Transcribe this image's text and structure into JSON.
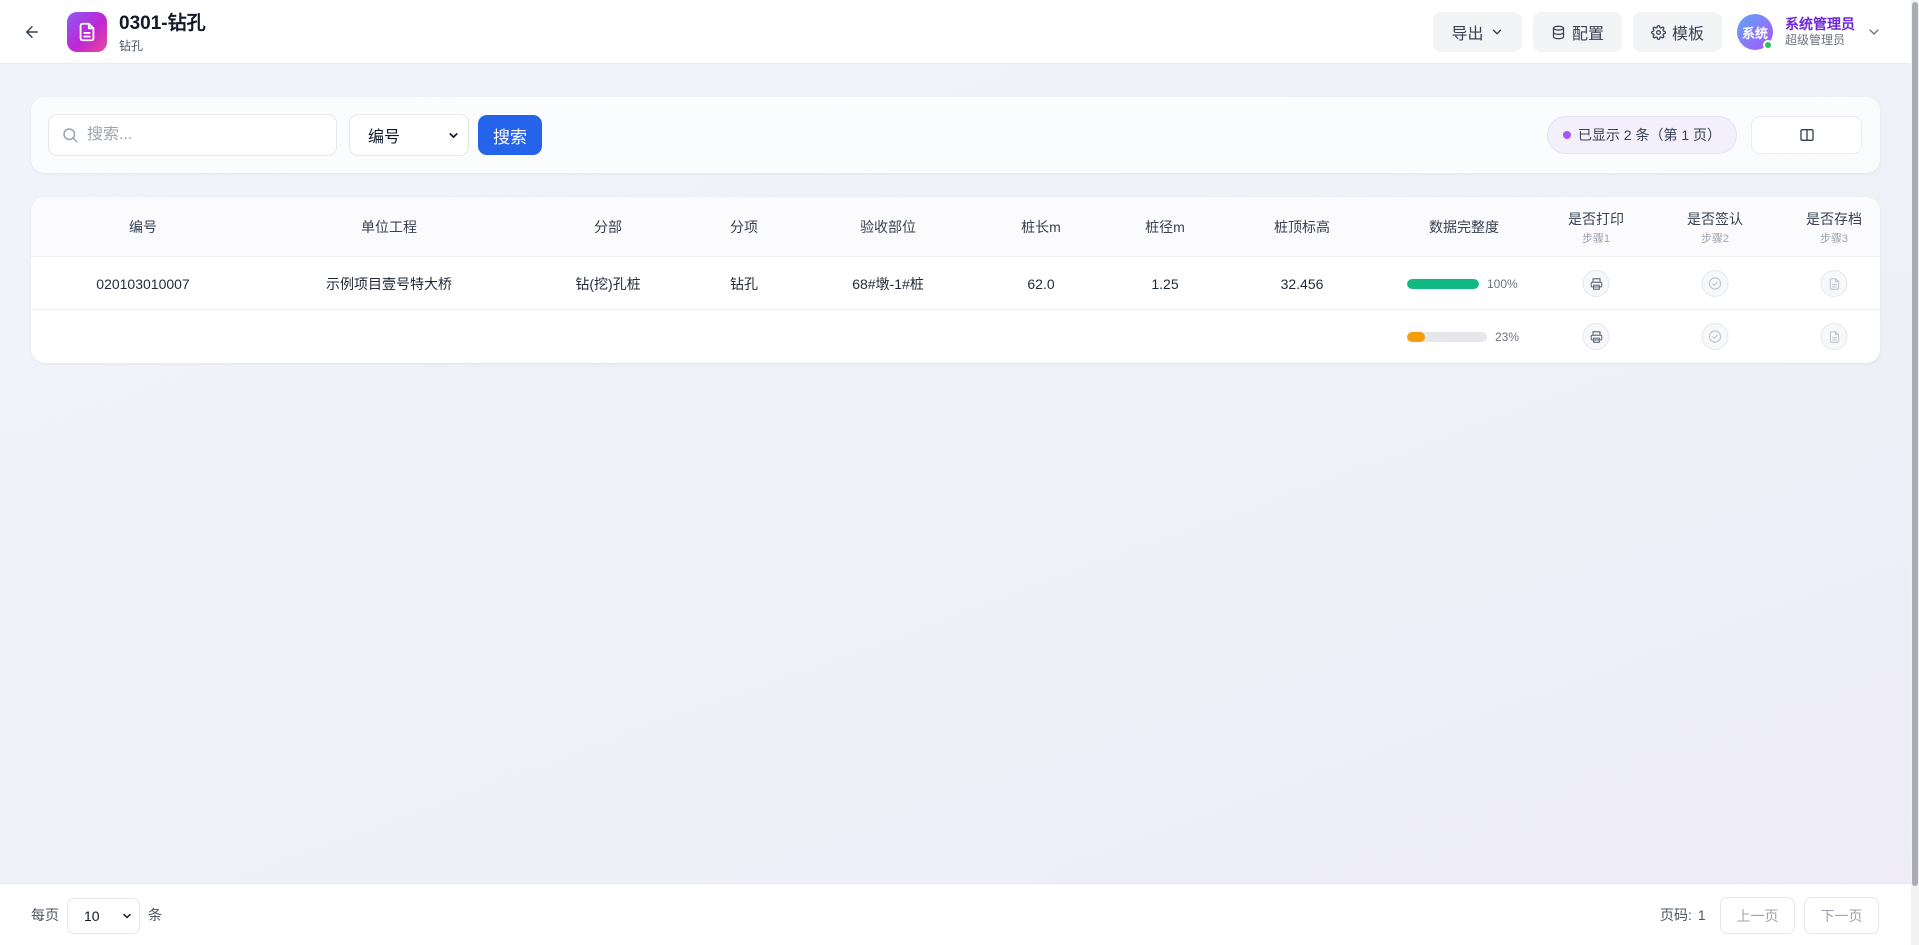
{
  "header": {
    "title": "0301-钻孔",
    "subtitle": "钻孔",
    "export_label": "导出",
    "config_label": "配置",
    "template_label": "模板",
    "user": {
      "avatar_text": "系统",
      "name": "系统管理员",
      "role": "超级管理员"
    }
  },
  "toolbar": {
    "search_placeholder": "搜索...",
    "field_select_value": "编号",
    "search_button": "搜索",
    "count_text": "已显示 2 条（第 1 页）"
  },
  "table": {
    "columns": [
      {
        "label": "编号"
      },
      {
        "label": "单位工程"
      },
      {
        "label": "分部"
      },
      {
        "label": "分项"
      },
      {
        "label": "验收部位"
      },
      {
        "label": "桩长m"
      },
      {
        "label": "桩径m"
      },
      {
        "label": "桩顶标高"
      },
      {
        "label": "数据完整度"
      },
      {
        "label": "是否打印",
        "step": "步骤1"
      },
      {
        "label": "是否签认",
        "step": "步骤2"
      },
      {
        "label": "是否存档",
        "step": "步骤3"
      }
    ],
    "rows": [
      {
        "code": "020103010007",
        "unit_project": "示例项目壹号特大桥",
        "division": "钻(挖)孔桩",
        "item": "钻孔",
        "location": "68#墩-1#桩",
        "pile_length": "62.0",
        "pile_diameter": "1.25",
        "pile_top_elevation": "32.456",
        "completeness": 100,
        "completeness_text": "100%",
        "completeness_color": "#10b981"
      },
      {
        "code": "",
        "unit_project": "",
        "division": "",
        "item": "",
        "location": "",
        "pile_length": "",
        "pile_diameter": "",
        "pile_top_elevation": "",
        "completeness": 23,
        "completeness_text": "23%",
        "completeness_color": "#f59e0b"
      }
    ]
  },
  "footer": {
    "per_page_label": "每页",
    "per_page_value": "10",
    "per_page_unit": "条",
    "page_label": "页码:",
    "page_number": "1",
    "prev_label": "上一页",
    "next_label": "下一页"
  },
  "icons": {
    "back": "arrow-left-icon",
    "app": "document-icon",
    "export_caret": "chevron-down-icon",
    "config": "database-icon",
    "template": "gear-icon",
    "search": "search-icon",
    "columns": "columns-icon",
    "print": "printer-icon",
    "sign": "check-circle-icon",
    "archive": "file-icon"
  },
  "colors": {
    "primary": "#2563eb",
    "accent_purple": "#a855f7",
    "complete_green": "#10b981",
    "partial_orange": "#f59e0b"
  }
}
